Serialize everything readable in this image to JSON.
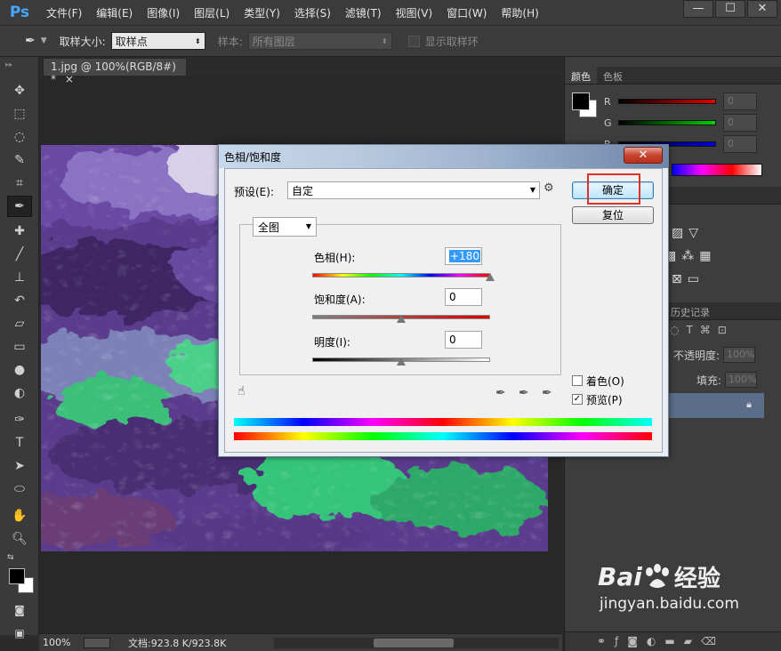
{
  "app": {
    "logo": "Ps",
    "window_controls": [
      "—",
      "☐",
      "✕"
    ]
  },
  "menu": [
    "文件(F)",
    "编辑(E)",
    "图像(I)",
    "图层(L)",
    "类型(Y)",
    "选择(S)",
    "滤镜(T)",
    "视图(V)",
    "窗口(W)",
    "帮助(H)"
  ],
  "options_bar": {
    "sample_size_label": "取样大小:",
    "sample_size_value": "取样点",
    "sample_label": "样本:",
    "sample_value": "所有图层",
    "show_ring_label": "显示取样环"
  },
  "document": {
    "tab_title": "1.jpg @ 100%(RGB/8#) *",
    "tab_close": "×",
    "zoom": "100%",
    "doc_info": "文档:923.8 K/923.8K"
  },
  "color_panel": {
    "tabs": [
      "颜色",
      "色板"
    ],
    "channels": [
      {
        "label": "R",
        "value": "0",
        "color": "#c81e1e"
      },
      {
        "label": "G",
        "value": "0",
        "color": "#1eb41e"
      },
      {
        "label": "B",
        "value": "0",
        "color": "#1e1ec8"
      }
    ]
  },
  "layers_panel": {
    "tabs": [
      "历史记录"
    ],
    "opacity_label": "不透明度:",
    "opacity_value": "100%",
    "fill_label": "填充:",
    "fill_value": "100%"
  },
  "dialog": {
    "title": "色相/饱和度",
    "close": "✕",
    "preset_label": "预设(E):",
    "preset_value": "自定",
    "ok_label": "确定",
    "reset_label": "复位",
    "range_value": "全图",
    "hue_label": "色相(H):",
    "hue_value": "+180",
    "hue_level": 180,
    "saturation_label": "饱和度(A):",
    "saturation_value": "0",
    "lightness_label": "明度(I):",
    "lightness_value": "0",
    "colorize_label": "着色(O)",
    "colorize_checked": false,
    "preview_label": "预览(P)",
    "preview_checked": true
  },
  "watermark": {
    "brand": "Bai",
    "brand2": "经验",
    "url": "jingyan.baidu.com"
  }
}
